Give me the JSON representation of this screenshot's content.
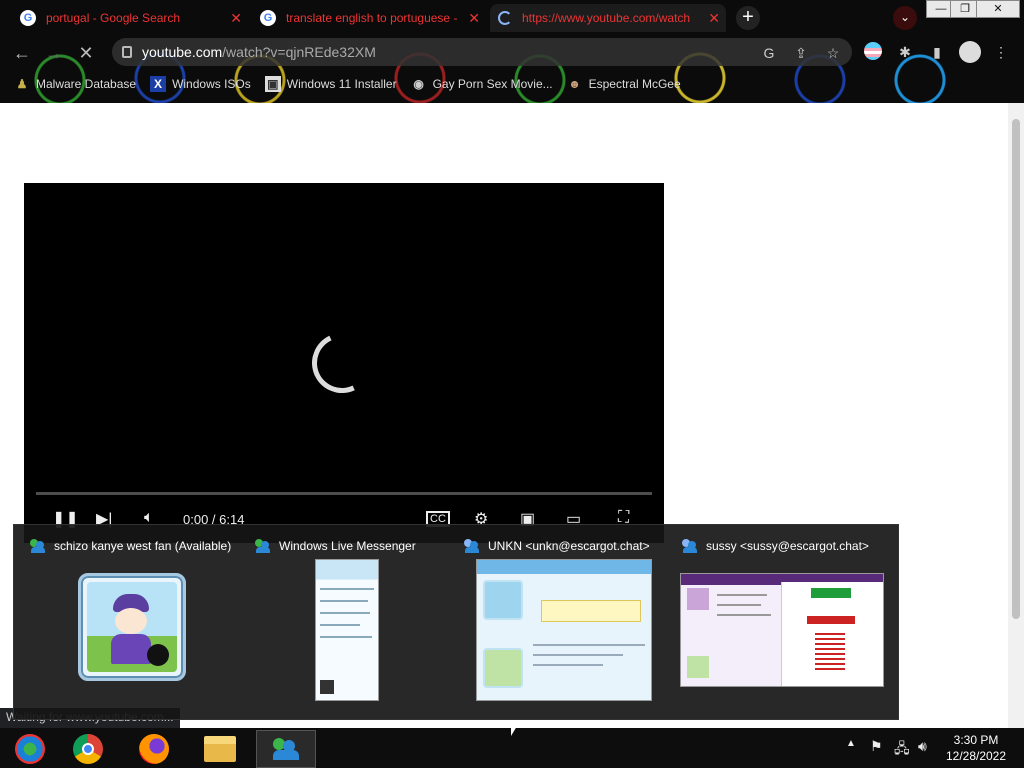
{
  "browser": {
    "tabs": [
      {
        "title": "portugal - Google Search",
        "favicon": "G"
      },
      {
        "title": "translate english to portuguese -",
        "favicon": "G"
      },
      {
        "title": "https://www.youtube.com/watch",
        "favicon": "loading-spinner"
      }
    ],
    "new_tab_label": "+",
    "tab_search_label": "⌄",
    "window_controls": {
      "minimize": "—",
      "restore": "❐",
      "close": "✕"
    },
    "address": {
      "host": "youtube.com",
      "path": "/watch?v=qjnREde32XM"
    },
    "bookmarks": [
      {
        "label": "Malware Database",
        "icon": "malware-icon"
      },
      {
        "label": "Windows ISOs",
        "icon": "x-icon"
      },
      {
        "label": "Windows 11 Installer",
        "icon": "installer-icon"
      },
      {
        "label": "Gay Porn Sex Movie...",
        "icon": "bookmark-icon"
      },
      {
        "label": "Espectral McGee",
        "icon": "bookmark-icon"
      }
    ],
    "status_text": "Waiting for www.youtube.com..."
  },
  "video": {
    "time": "0:00 / 6:14",
    "progress": 0.0
  },
  "taskbar_preview": {
    "windows": [
      {
        "title": "schizo kanye west fan (Available)",
        "kind": "messenger-contact-list"
      },
      {
        "title": "Windows Live Messenger",
        "kind": "messenger-main"
      },
      {
        "title": "UNKN <unkn@escargot.chat>",
        "kind": "messenger-conversation"
      },
      {
        "title": "sussy <sussy@escargot.chat>",
        "kind": "messenger-conversation-game"
      }
    ]
  },
  "taskbar": {
    "apps": [
      {
        "name": "Windows Media Center",
        "icon": "media-center-icon"
      },
      {
        "name": "Google Chrome",
        "icon": "chrome-icon"
      },
      {
        "name": "Firefox",
        "icon": "firefox-icon"
      },
      {
        "name": "File Explorer",
        "icon": "folder-icon"
      },
      {
        "name": "Windows Live Messenger",
        "icon": "messenger-icon"
      }
    ],
    "clock": {
      "time": "3:30 PM",
      "date": "12/28/2022"
    }
  }
}
